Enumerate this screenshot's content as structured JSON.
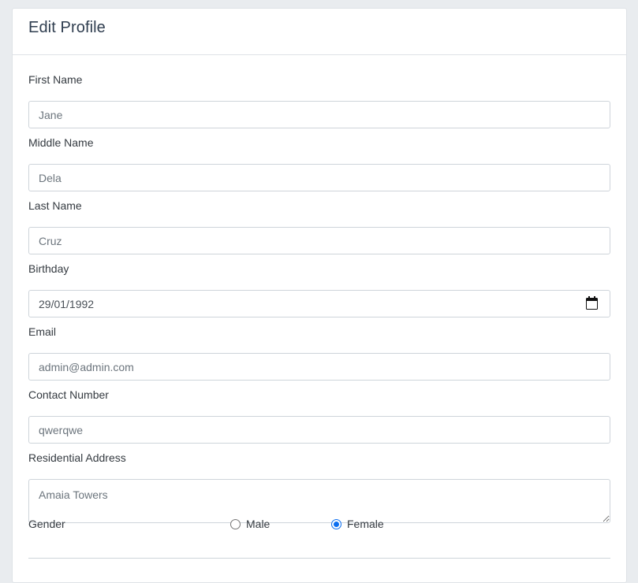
{
  "header": {
    "title": "Edit Profile"
  },
  "form": {
    "first_name": {
      "label": "First Name",
      "placeholder": "Jane"
    },
    "middle_name": {
      "label": "Middle Name",
      "placeholder": "Dela"
    },
    "last_name": {
      "label": "Last Name",
      "placeholder": "Cruz"
    },
    "birthday": {
      "label": "Birthday",
      "value": "29/01/1992"
    },
    "email": {
      "label": "Email",
      "placeholder": "admin@admin.com"
    },
    "contact_number": {
      "label": "Contact Number",
      "placeholder": "qwerqwe"
    },
    "address": {
      "label": "Residential Address",
      "placeholder": "Amaia Towers"
    },
    "gender": {
      "label": "Gender",
      "options": [
        {
          "label": "Male",
          "checked": false
        },
        {
          "label": "Female",
          "checked": true
        }
      ]
    }
  },
  "colors": {
    "accent": "#0b6ef0",
    "background": "#e9ecef",
    "border": "#ced4da"
  }
}
